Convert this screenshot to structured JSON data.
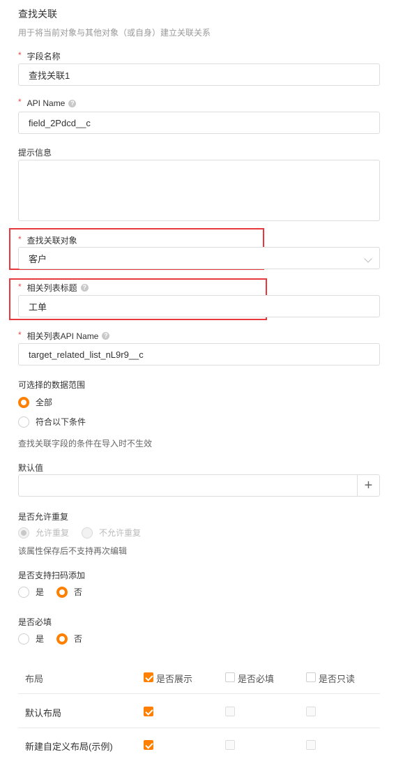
{
  "header": {
    "title": "查找关联",
    "subtitle": "用于将当前对象与其他对象（或自身）建立关联关系"
  },
  "fields": {
    "field_name": {
      "label": "字段名称",
      "value": "查找关联1"
    },
    "api_name": {
      "label": "API Name",
      "value": "field_2Pdcd__c"
    },
    "hint": {
      "label": "提示信息",
      "value": ""
    },
    "lookup_object": {
      "label": "查找关联对象",
      "value": "客户"
    },
    "related_list_title": {
      "label": "相关列表标题",
      "value": "工单"
    },
    "related_list_api": {
      "label": "相关列表API Name",
      "value": "target_related_list_nL9r9__c"
    }
  },
  "data_range": {
    "label": "可选择的数据范围",
    "options": [
      "全部",
      "符合以下条件"
    ],
    "selected": "全部",
    "note": "查找关联字段的条件在导入时不生效"
  },
  "default_value": {
    "label": "默认值",
    "value": "",
    "add_symbol": "+"
  },
  "allow_duplicate": {
    "label": "是否允许重复",
    "options": [
      "允许重复",
      "不允许重复"
    ],
    "note": "该属性保存后不支持再次编辑"
  },
  "scan_add": {
    "label": "是否支持扫码添加",
    "options": [
      "是",
      "否"
    ],
    "selected": "否"
  },
  "required": {
    "label": "是否必填",
    "options": [
      "是",
      "否"
    ],
    "selected": "否"
  },
  "layout_table": {
    "headers": [
      "布局",
      "是否展示",
      "是否必填",
      "是否只读"
    ],
    "rows": [
      {
        "name": "默认布局",
        "show": true,
        "required": false,
        "readonly": false
      },
      {
        "name": "新建自定义布局(示例)",
        "show": true,
        "required": false,
        "readonly": false
      }
    ]
  },
  "colors": {
    "accent": "#ff8000",
    "required_mark": "#f04a4a",
    "highlight_box": "#e8383d"
  }
}
